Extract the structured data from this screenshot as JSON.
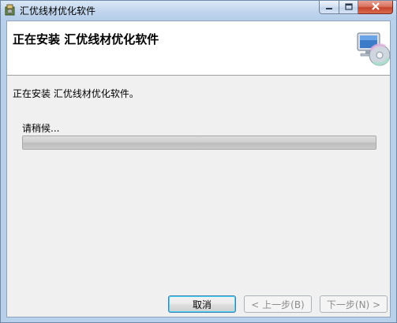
{
  "window": {
    "title": "汇优线材优化软件"
  },
  "icons": {
    "app": "installer-app-icon",
    "banner": "computer-cd-setup-icon",
    "minimize": "minimize-icon",
    "maximize": "maximize-icon",
    "close": "close-icon"
  },
  "banner": {
    "title": "正在安装 汇优线材优化软件"
  },
  "body": {
    "status_text": "正在安装 汇优线材优化软件。",
    "wait_text": "请稍候...",
    "progress": 1.0
  },
  "buttons": {
    "cancel": "取消",
    "back": "< 上一步(B)",
    "next": "下一步(N) >"
  },
  "colors": {
    "titlebar": "#c3d7ee",
    "client_bg": "#f0f0f0",
    "banner_bg": "#ffffff",
    "close_button": "#c5432b",
    "default_button_focus": "#48d5f5"
  }
}
